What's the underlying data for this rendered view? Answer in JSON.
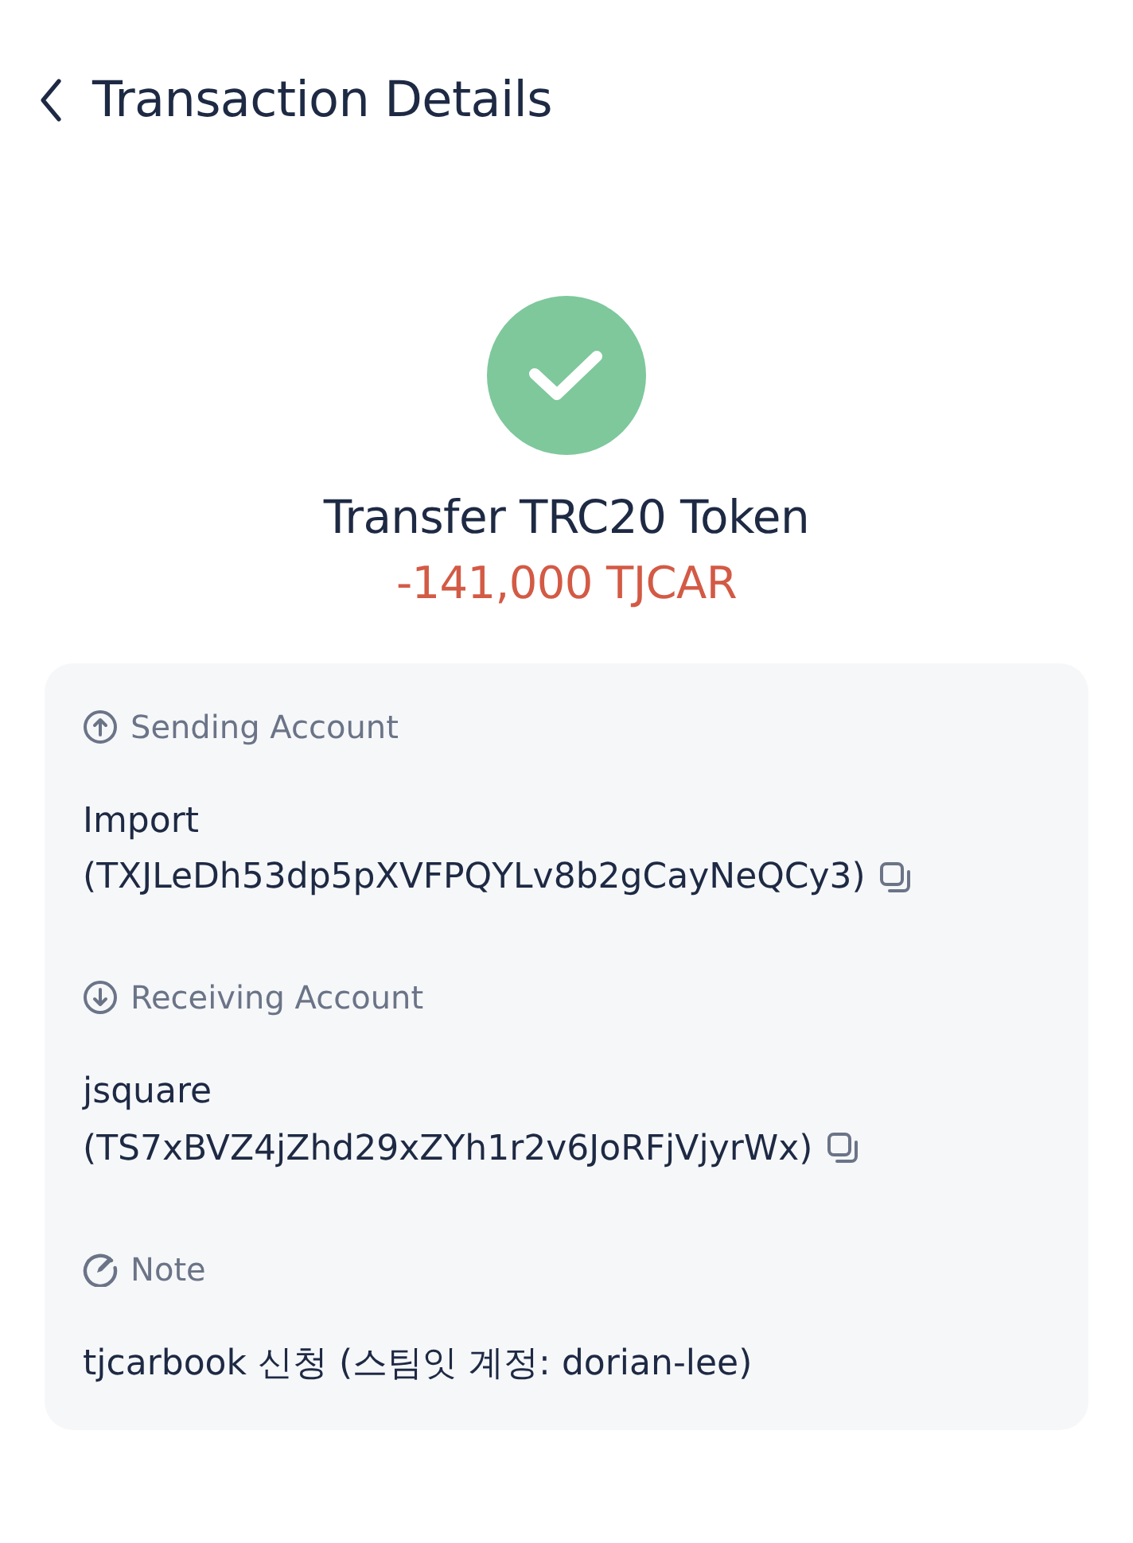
{
  "header": {
    "title": "Transaction Details"
  },
  "status": {
    "kind": "success"
  },
  "summary": {
    "title": "Transfer TRC20 Token",
    "amount": "-141,000 TJCAR"
  },
  "sections": [
    {
      "kind": "sending",
      "label": "Sending Account",
      "name": "Import",
      "address": "(TXJLeDh53dp5pXVFPQYLv8b2gCayNeQCy3)",
      "copyable": true
    },
    {
      "kind": "receiving",
      "label": "Receiving Account",
      "name": "jsquare",
      "address": "(TS7xBVZ4jZhd29xZYh1r2v6JoRFjVjyrWx)",
      "copyable": true
    },
    {
      "kind": "note",
      "label": "Note",
      "text": "tjcarbook 신청 (스팀잇 계정: dorian-lee)"
    }
  ]
}
